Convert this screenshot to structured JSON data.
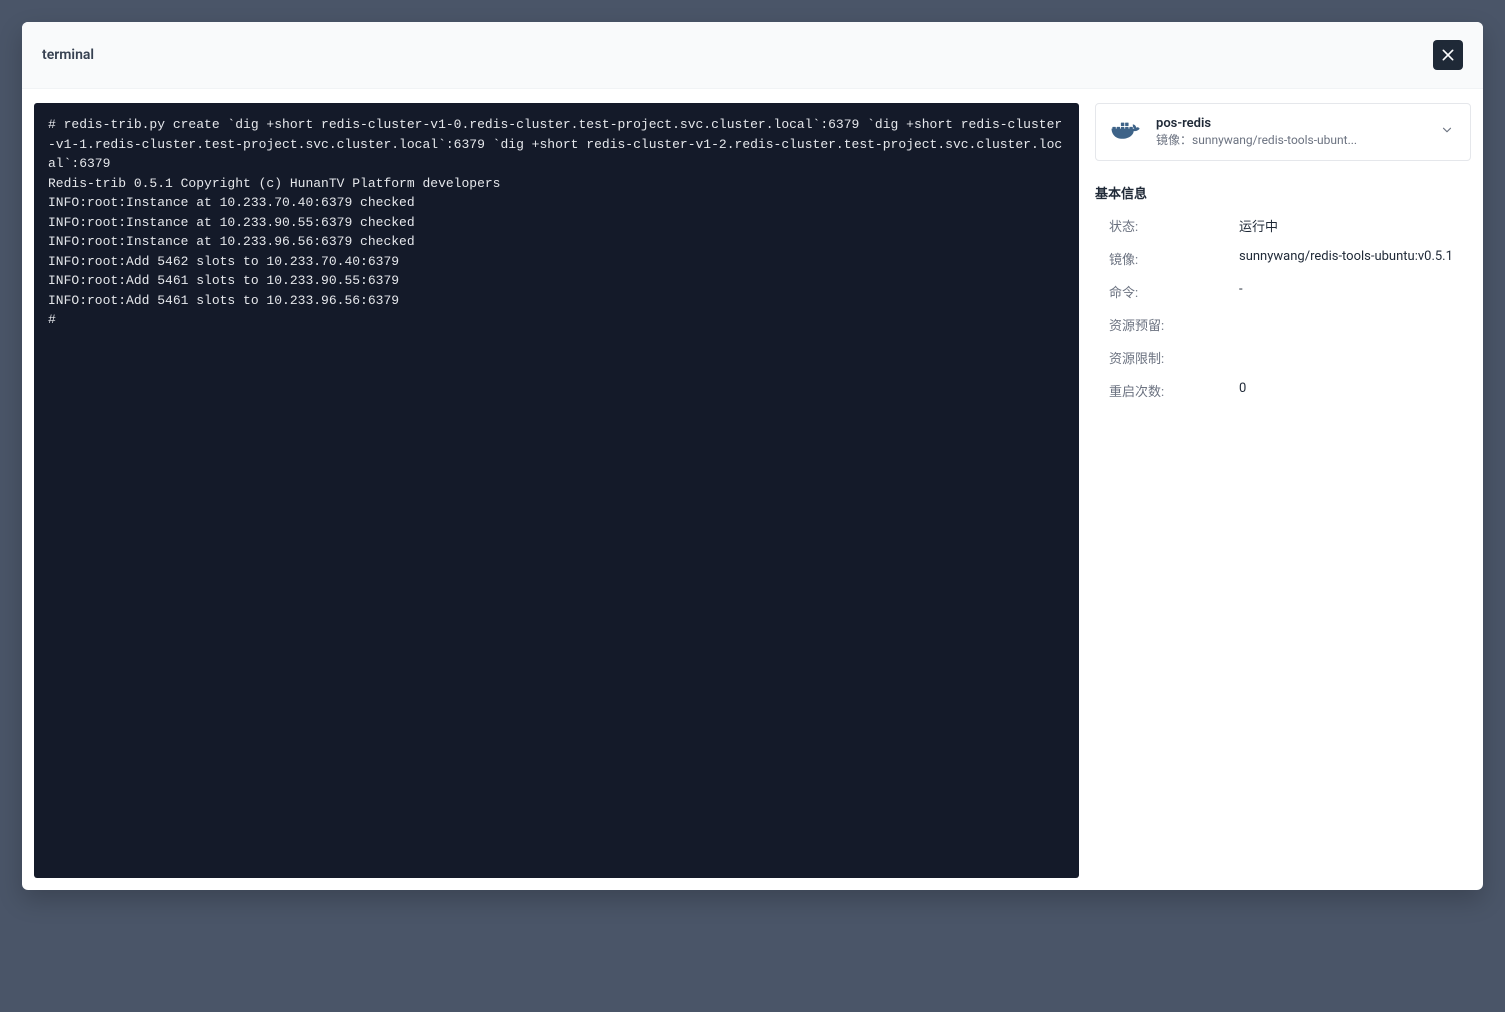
{
  "modal": {
    "title": "terminal"
  },
  "terminal": {
    "output": "# redis-trib.py create `dig +short redis-cluster-v1-0.redis-cluster.test-project.svc.cluster.local`:6379 `dig +short redis-cluster-v1-1.redis-cluster.test-project.svc.cluster.local`:6379 `dig +short redis-cluster-v1-2.redis-cluster.test-project.svc.cluster.local`:6379\nRedis-trib 0.5.1 Copyright (c) HunanTV Platform developers\nINFO:root:Instance at 10.233.70.40:6379 checked\nINFO:root:Instance at 10.233.90.55:6379 checked\nINFO:root:Instance at 10.233.96.56:6379 checked\nINFO:root:Add 5462 slots to 10.233.70.40:6379\nINFO:root:Add 5461 slots to 10.233.90.55:6379\nINFO:root:Add 5461 slots to 10.233.96.56:6379\n#"
  },
  "sidebar": {
    "container": {
      "name": "pos-redis",
      "image_prefix": "镜像：",
      "image_display": "sunnywang/redis-tools-ubunt..."
    },
    "section_title": "基本信息",
    "info": {
      "status": {
        "label": "状态:",
        "value": "运行中"
      },
      "image": {
        "label": "镜像:",
        "value": "sunnywang/redis-tools-ubuntu:v0.5.1"
      },
      "command": {
        "label": "命令:",
        "value": "-"
      },
      "resource_reserve": {
        "label": "资源预留:",
        "value": ""
      },
      "resource_limit": {
        "label": "资源限制:",
        "value": ""
      },
      "restart_count": {
        "label": "重启次数:",
        "value": "0"
      }
    }
  }
}
